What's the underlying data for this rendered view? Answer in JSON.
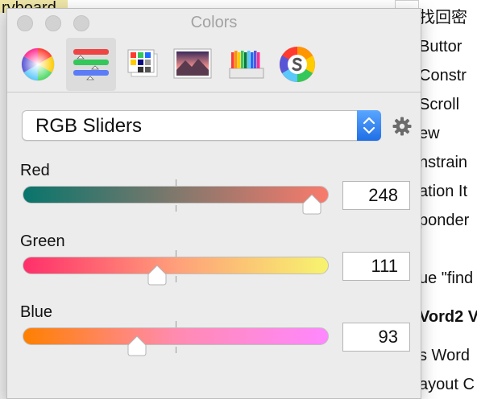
{
  "background_app": {
    "top_left_text": "ryboard",
    "right_lines": [
      {
        "text": "找回密",
        "bold": false
      },
      {
        "text": "Buttor",
        "bold": false
      },
      {
        "text": "Constr",
        "bold": false
      },
      {
        "text": "Scroll",
        "bold": false
      },
      {
        "text": "ew",
        "bold": false
      },
      {
        "text": "nstrain",
        "bold": false
      },
      {
        "text": "ation It",
        "bold": false
      },
      {
        "text": "ponder",
        "bold": false
      },
      {
        "text": "ue \"find",
        "bold": false
      },
      {
        "text": "Vord2 V",
        "bold": true
      },
      {
        "text": "s Word",
        "bold": false
      },
      {
        "text": "ayout C",
        "bold": false
      }
    ]
  },
  "colors_panel": {
    "title": "Colors",
    "toolbar": {
      "items": [
        {
          "name": "color-wheel",
          "icon": "color-wheel-icon",
          "selected": false
        },
        {
          "name": "color-sliders",
          "icon": "sliders-icon",
          "selected": true
        },
        {
          "name": "color-palettes",
          "icon": "palettes-icon",
          "selected": false
        },
        {
          "name": "image-palettes",
          "icon": "image-palette-icon",
          "selected": false
        },
        {
          "name": "pencils",
          "icon": "pencils-icon",
          "selected": false
        },
        {
          "name": "third-party-picker",
          "icon": "s-wheel-icon",
          "selected": false
        }
      ]
    },
    "mode": {
      "selected": "RGB Sliders",
      "stepper_icon": "up-down-chevron-icon",
      "settings_icon": "gear-icon"
    },
    "sliders": [
      {
        "label": "Red",
        "value": "248",
        "fraction": 0.973,
        "gradient": [
          "#08756c",
          "#f97a6c"
        ]
      },
      {
        "label": "Green",
        "value": "111",
        "fraction": 0.435,
        "gradient": [
          "#ff2f6a",
          "#ff9f7a",
          "#f7f46e"
        ]
      },
      {
        "label": "Blue",
        "value": "93",
        "fraction": 0.365,
        "gradient": [
          "#ff8000",
          "#ff8bb0",
          "#ff88ff"
        ]
      }
    ]
  }
}
